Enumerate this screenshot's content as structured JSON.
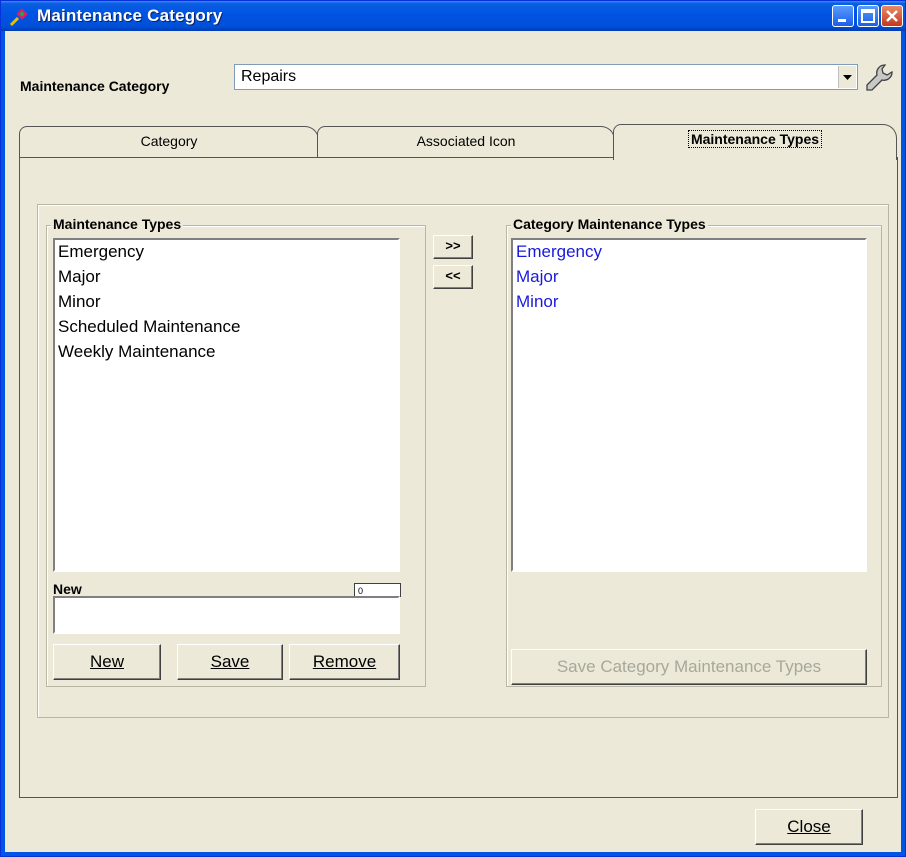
{
  "window": {
    "title": "Maintenance Category"
  },
  "header": {
    "category_label": "Maintenance Category",
    "category_value": "Repairs"
  },
  "tabs": [
    {
      "label": "Category"
    },
    {
      "label": "Associated Icon"
    },
    {
      "label": "Maintenance Types"
    }
  ],
  "left_group": {
    "title": "Maintenance Types",
    "items": [
      "Emergency",
      "Major",
      "Minor",
      "Scheduled Maintenance",
      "Weekly Maintenance"
    ],
    "new_label": "New",
    "new_value": "",
    "counter_value": "0",
    "buttons": {
      "new": "New",
      "save": "Save",
      "remove": "Remove"
    }
  },
  "transfer": {
    "add": ">>",
    "remove": "<<"
  },
  "right_group": {
    "title": "Category Maintenance Types",
    "items": [
      "Emergency",
      "Major",
      "Minor"
    ],
    "save_button": "Save Category Maintenance Types"
  },
  "footer": {
    "close": "Close"
  },
  "colors": {
    "titlebar": "#0054e3",
    "client": "#ece9d8",
    "selected_text": "#1a1adc",
    "disabled_text": "#a8a89a"
  }
}
